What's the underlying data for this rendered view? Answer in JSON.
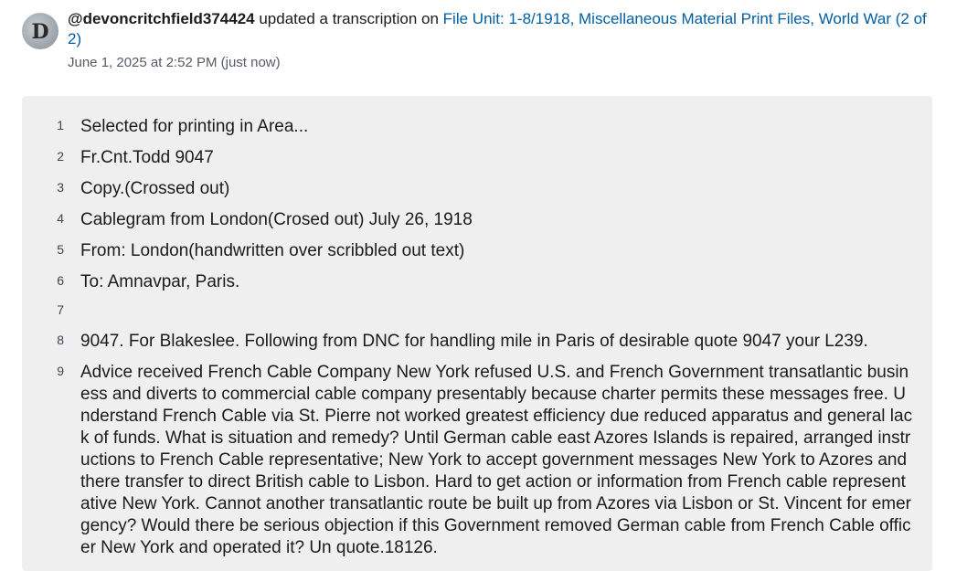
{
  "activity": {
    "avatar_icon": "user-avatar-icon",
    "username": "@devoncritchfield374424",
    "action": "updated a transcription on",
    "file_link": "File Unit: 1-8/1918, Miscellaneous Material Print Files, World War (2 of 2)",
    "timestamp": "June 1, 2025 at 2:52 PM (just now)"
  },
  "transcription": {
    "lines": [
      {
        "num": "1",
        "text": "Selected for printing in Area..."
      },
      {
        "num": "2",
        "text": "Fr.Cnt.Todd 9047"
      },
      {
        "num": "3",
        "text": "Copy.(Crossed out)"
      },
      {
        "num": "4",
        "text": "Cablegram from London(Crosed out) July 26, 1918"
      },
      {
        "num": "5",
        "text": "From: London(handwritten over scribbled out text)"
      },
      {
        "num": "6",
        "text": "To: Amnavpar, Paris."
      },
      {
        "num": "7",
        "text": ""
      },
      {
        "num": "8",
        "text": "9047. For Blakeslee. Following from DNC for handling mile in Paris of desirable quote 9047 your L239."
      },
      {
        "num": "9",
        "text": "Advice received French Cable Company New York refused U.S. and French Government transatlantic business and diverts to commercial cable company presentably because charter permits these messages free. Understand French Cable via St. Pierre not worked greatest efficiency due reduced apparatus and general lack of funds. What is situation and remedy? Until German cable east Azores Islands is repaired, arranged instructions to French Cable representative; New York to accept government messages New York to Azores and there transfer to direct British cable to Lisbon. Hard to get action or information from French cable representative New York. Cannot another transatlantic route be built up from Azores via Lisbon or St. Vincent for emergency? Would there be serious objection if this Government removed German cable from French Cable officer New York and operated it? Un quote.18126."
      }
    ]
  }
}
